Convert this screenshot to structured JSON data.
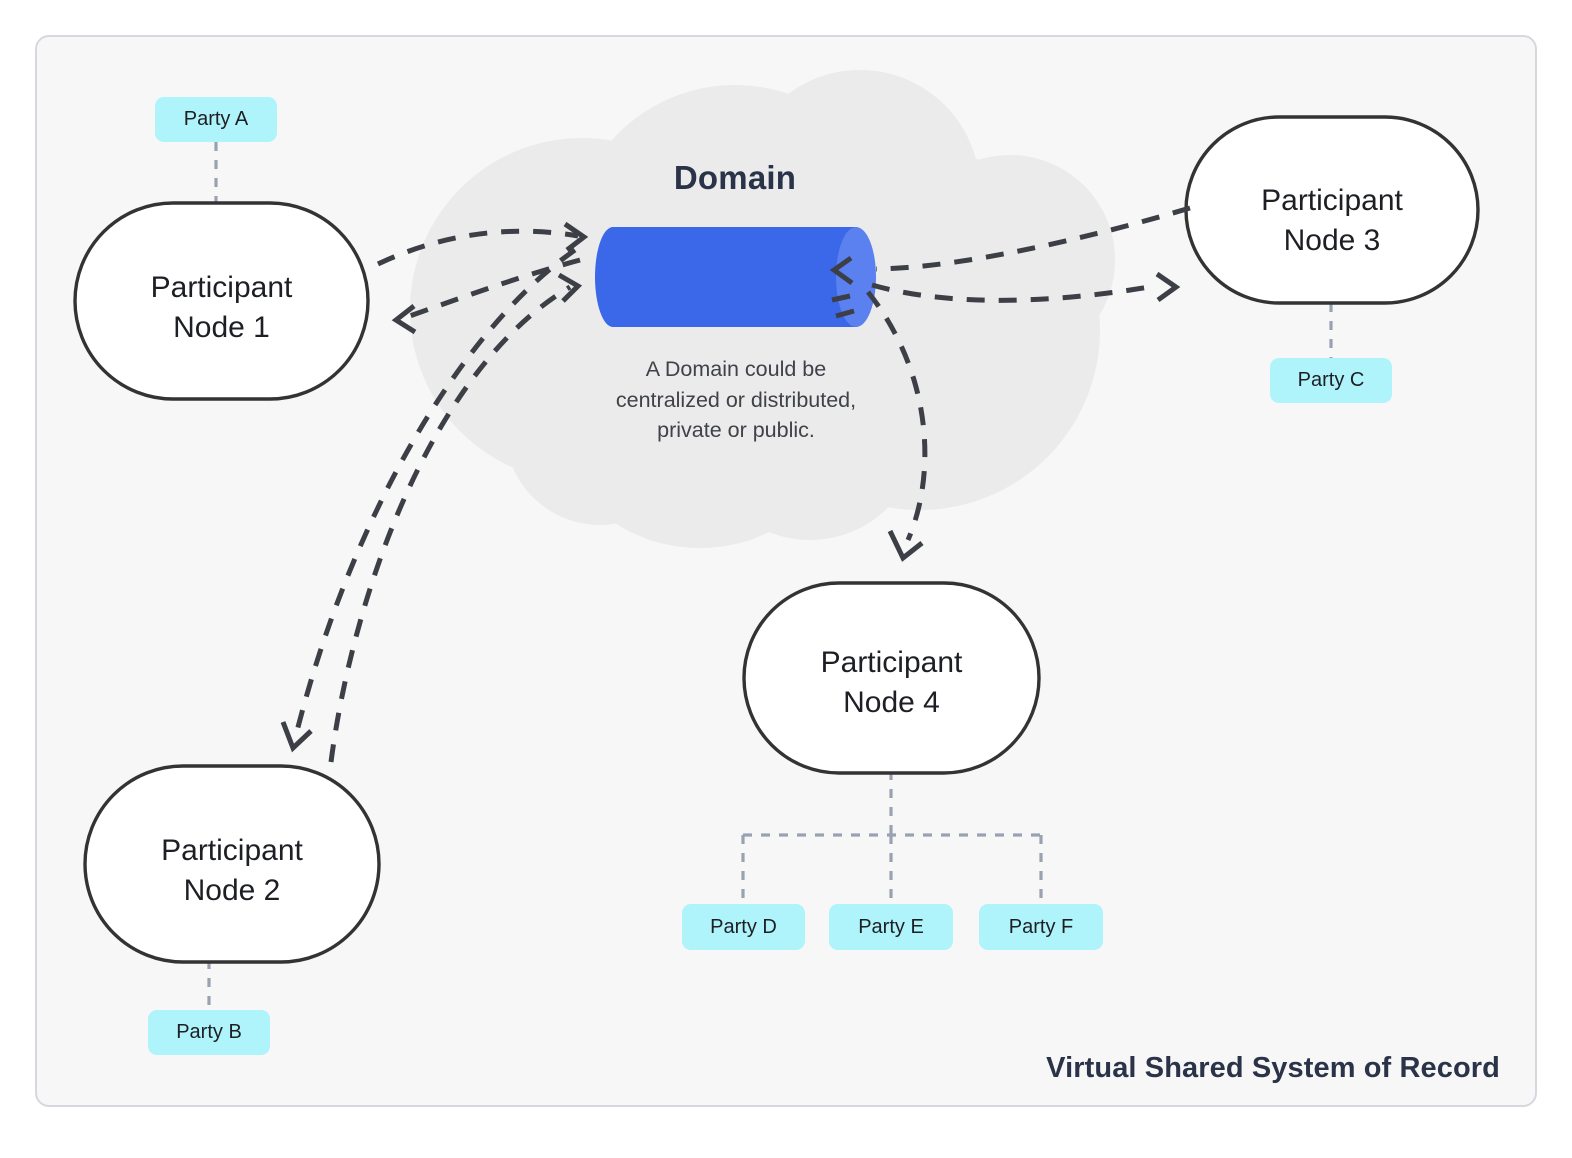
{
  "diagram": {
    "footer_caption": "Virtual Shared System of Record",
    "background_color": "#f7f7f8",
    "panel_border_color": "#d6d8de",
    "cloud_color": "#ebebeb",
    "cylinder_body_color": "#3a68e8",
    "cylinder_cap_color": "#5b80ef",
    "party_chip_color": "#aff3fb",
    "node_stroke_color": "#333333",
    "arrow_color": "#3c3f45",
    "connector_color": "#9aa2b1",
    "title_color": "#2b3348"
  },
  "domain": {
    "title": "Domain",
    "caption": "A Domain could be\ncentralized or distributed,\nprivate or public."
  },
  "nodes": [
    {
      "id": "node1",
      "label": "Participant\nNode 1"
    },
    {
      "id": "node2",
      "label": "Participant\nNode 2"
    },
    {
      "id": "node3",
      "label": "Participant\nNode 3"
    },
    {
      "id": "node4",
      "label": "Participant\nNode 4"
    }
  ],
  "parties": [
    {
      "id": "partyA",
      "label": "Party A",
      "node": "node1"
    },
    {
      "id": "partyB",
      "label": "Party B",
      "node": "node2"
    },
    {
      "id": "partyC",
      "label": "Party C",
      "node": "node3"
    },
    {
      "id": "partyD",
      "label": "Party D",
      "node": "node4"
    },
    {
      "id": "partyE",
      "label": "Party E",
      "node": "node4"
    },
    {
      "id": "partyF",
      "label": "Party F",
      "node": "node4"
    }
  ]
}
